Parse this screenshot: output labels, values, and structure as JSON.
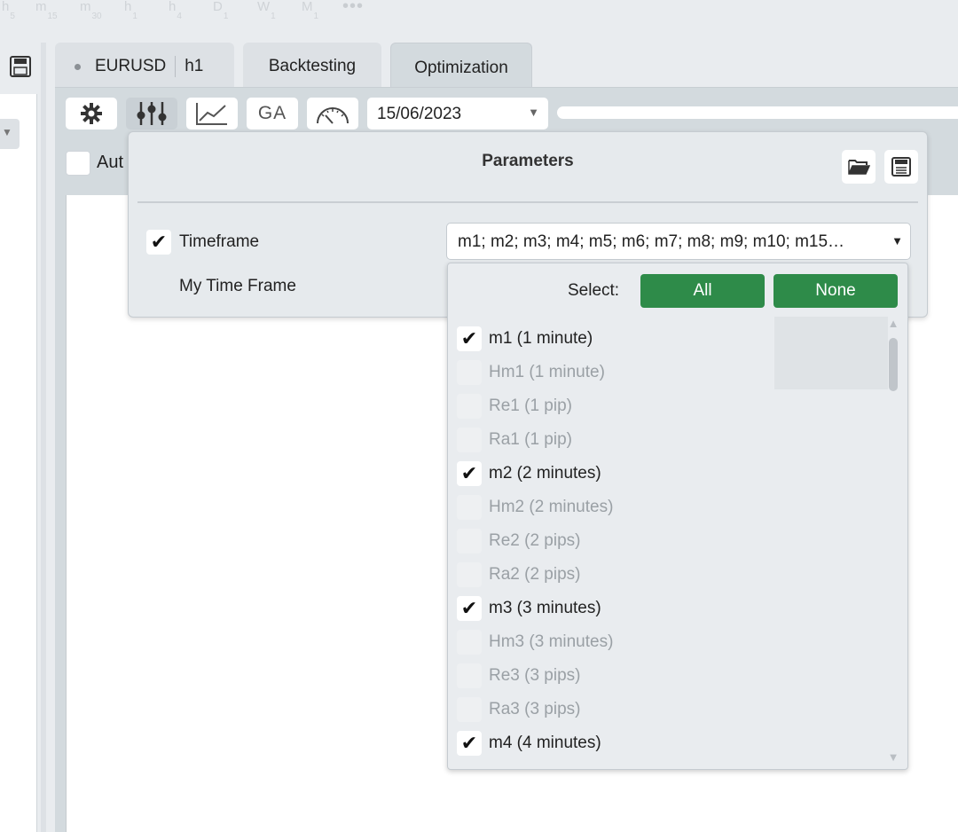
{
  "timeframe_strip": [
    {
      "main": "h",
      "sub": "5"
    },
    {
      "main": "m",
      "sub": "15"
    },
    {
      "main": "m",
      "sub": "30"
    },
    {
      "main": "h",
      "sub": "1"
    },
    {
      "main": "h",
      "sub": "4"
    },
    {
      "main": "D",
      "sub": "1"
    },
    {
      "main": "W",
      "sub": "1"
    },
    {
      "main": "M",
      "sub": "1"
    }
  ],
  "timeframe_more": "•••",
  "tabs": {
    "chart_symbol": "EURUSD",
    "chart_period": "h1",
    "backtesting": "Backtesting",
    "optimization": "Optimization"
  },
  "toolbar": {
    "ga_label": "GA",
    "date_value": "15/06/2023",
    "auto_label": "Aut"
  },
  "parameters": {
    "title": "Parameters",
    "timeframe_label": "Timeframe",
    "timeframe_value": "m1; m2; m3; m4; m5; m6; m7; m8; m9; m10; m15…",
    "my_timeframe_label": "My Time Frame"
  },
  "dropdown": {
    "select_label": "Select:",
    "all_label": "All",
    "none_label": "None",
    "items": [
      {
        "label": "m1 (1 minute)",
        "checked": true
      },
      {
        "label": "Hm1 (1 minute)",
        "checked": false
      },
      {
        "label": "Re1 (1 pip)",
        "checked": false
      },
      {
        "label": "Ra1 (1 pip)",
        "checked": false
      },
      {
        "label": "m2 (2 minutes)",
        "checked": true
      },
      {
        "label": "Hm2 (2 minutes)",
        "checked": false
      },
      {
        "label": "Re2 (2 pips)",
        "checked": false
      },
      {
        "label": "Ra2 (2 pips)",
        "checked": false
      },
      {
        "label": "m3 (3 minutes)",
        "checked": true
      },
      {
        "label": "Hm3 (3 minutes)",
        "checked": false
      },
      {
        "label": "Re3 (3 pips)",
        "checked": false
      },
      {
        "label": "Ra3 (3 pips)",
        "checked": false
      },
      {
        "label": "m4 (4 minutes)",
        "checked": true
      }
    ]
  },
  "colors": {
    "accent_green": "#2e8b49",
    "panel_bg": "#d3dade",
    "popup_bg": "#e6eaed"
  }
}
